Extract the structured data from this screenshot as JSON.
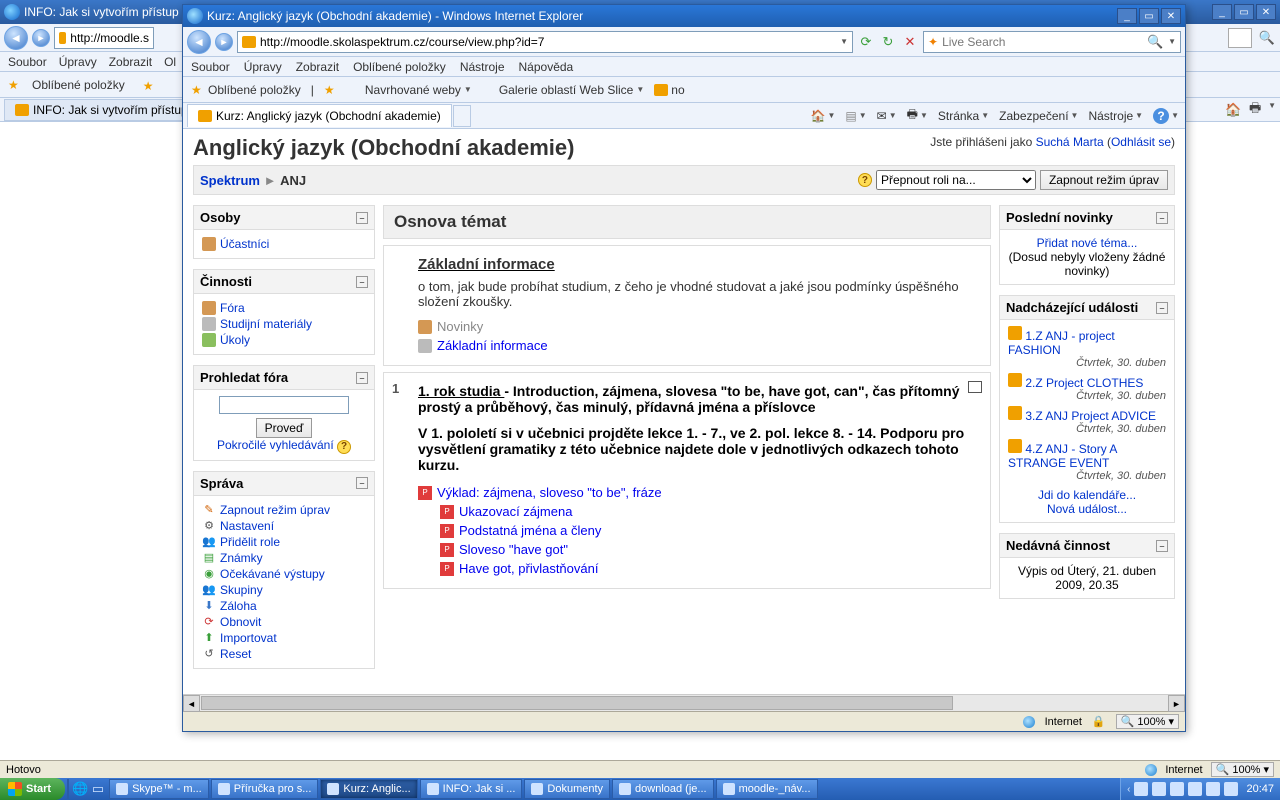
{
  "bg": {
    "title": "INFO: Jak si vytvořím přístup",
    "url_prefix": "http://moodle.s",
    "moodle_icon": "m",
    "menubar": [
      "Soubor",
      "Úpravy",
      "Zobrazit",
      "Ol"
    ],
    "favlabel": "Oblíbené položky",
    "tab_title": "INFO: Jak si vytvořím přístup ke",
    "status_left": "Hotovo",
    "status_zone": "Internet",
    "status_zoom": "100%"
  },
  "fg": {
    "title": "Kurz: Anglický jazyk (Obchodní akademie) - Windows Internet Explorer",
    "url": "http://moodle.skolaspektrum.cz/course/view.php?id=7",
    "search_placeholder": "Live Search",
    "menubar": [
      "Soubor",
      "Úpravy",
      "Zobrazit",
      "Oblíbené položky",
      "Nástroje",
      "Nápověda"
    ],
    "favbar": {
      "fav": "Oblíbené položky",
      "suggested": "Navrhované weby",
      "slice": "Galerie oblastí Web Slice",
      "no": "no"
    },
    "tab_title": "Kurz: Anglický jazyk (Obchodní akademie)",
    "cmdbar": {
      "page": "Stránka",
      "safety": "Zabezpečení",
      "tools": "Nástroje"
    },
    "status_zone": "Internet",
    "status_zoom": "100%"
  },
  "moodle": {
    "heading": "Anglický jazyk (Obchodní akademie)",
    "login_pre": "Jste přihlášeni jako ",
    "login_user": "Suchá Marta",
    "login_logout": "Odhlásit se",
    "bread_root": "Spektrum",
    "bread_cur": "ANJ",
    "role_select": "Přepnout roli na...",
    "btn_edit": "Zapnout režim úprav",
    "left": {
      "osoby_h": "Osoby",
      "ucastnici": "Účastníci",
      "cinnosti_h": "Činnosti",
      "fora": "Fóra",
      "studijni": "Studijní materiály",
      "ukoly": "Úkoly",
      "search_h": "Prohledat fóra",
      "search_btn": "Proveď",
      "advanced": "Pokročilé vyhledávání",
      "sprava_h": "Správa",
      "admin": [
        "Zapnout režim úprav",
        "Nastavení",
        "Přidělit role",
        "Známky",
        "Očekávané výstupy",
        "Skupiny",
        "Záloha",
        "Obnovit",
        "Importovat",
        "Reset"
      ]
    },
    "center": {
      "heading": "Osnova témat",
      "t0": {
        "title": "Základní informace",
        "desc": "o tom, jak bude probíhat studium, z čeho je vhodné studovat a jaké jsou podmínky úspěšného složení zkoušky.",
        "r1": "Novinky",
        "r2": "Základní informace"
      },
      "t1": {
        "num": "1",
        "title_pre": "1. rok studia ",
        "title_rest1": "- Introduction, zájmena, slovesa \"to be, have got, can\", čas přítomný prostý a průběhový, čas minulý, přídavná jména a příslovce",
        "para2": "V 1. pololetí si v učebnici projděte lekce 1. - 7., ve 2. pol. lekce 8. - 14. Podporu pro vysvětlení gramatiky z této učebnice najdete dole v jednotlivých odkazech tohoto kurzu.",
        "res": [
          "Výklad: zájmena, sloveso \"to be\", fráze",
          "Ukazovací zájmena",
          "Podstatná jména a členy",
          "Sloveso \"have got\"",
          "Have got, přivlastňování"
        ]
      }
    },
    "right": {
      "news_h": "Poslední novinky",
      "news_add": "Přidat nové téma...",
      "news_empty": "(Dosud nebyly vloženy žádné novinky)",
      "events_h": "Nadcházející události",
      "events": [
        {
          "t": "1.Z ANJ - project FASHION",
          "d": "Čtvrtek, 30. duben"
        },
        {
          "t": "2.Z Project CLOTHES",
          "d": "Čtvrtek, 30. duben"
        },
        {
          "t": "3.Z ANJ Project ADVICE",
          "d": "Čtvrtek, 30. duben"
        },
        {
          "t": "4.Z ANJ - Story A STRANGE EVENT",
          "d": "Čtvrtek, 30. duben"
        }
      ],
      "cal_link": "Jdi do kalendáře...",
      "new_event": "Nová událost...",
      "recent_h": "Nedávná činnost",
      "recent_txt": "Výpis od Úterý, 21. duben 2009, 20.35"
    }
  },
  "taskbar": {
    "start": "Start",
    "items": [
      "Skype™ - m...",
      "Příručka pro s...",
      "Kurz: Anglic...",
      "INFO: Jak si ...",
      "Dokumenty",
      "download (je...",
      "moodle-_náv..."
    ],
    "active_idx": 2,
    "clock": "20:47"
  }
}
